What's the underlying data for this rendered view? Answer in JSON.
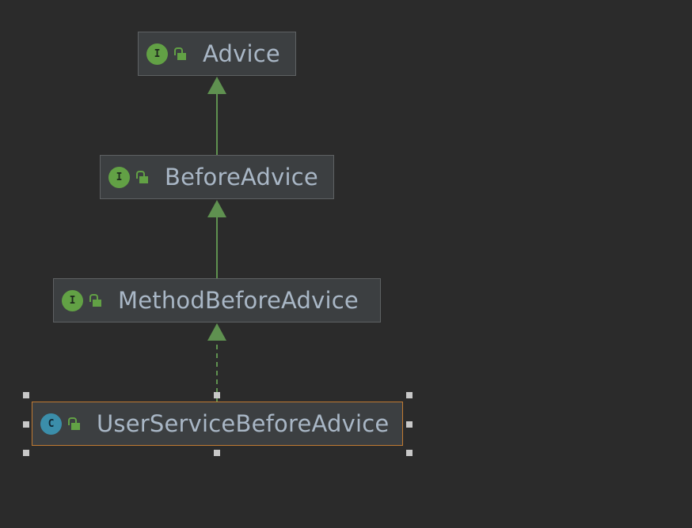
{
  "colors": {
    "background": "#2b2b2b",
    "node_fill": "#3c3f41",
    "node_border": "#5e6163",
    "selected_border": "#c07a32",
    "edge": "#5f9150",
    "interface_badge": "#62a145",
    "class_badge": "#3b8eaa",
    "text": "#a9b7c6"
  },
  "nodes": [
    {
      "id": "advice",
      "name": "Advice",
      "kind_letter": "I",
      "kind": "interface",
      "access": "public-lock-icon"
    },
    {
      "id": "before-advice",
      "name": "BeforeAdvice",
      "kind_letter": "I",
      "kind": "interface",
      "access": "public-lock-icon"
    },
    {
      "id": "method-before-advice",
      "name": "MethodBeforeAdvice",
      "kind_letter": "I",
      "kind": "interface",
      "access": "public-lock-icon"
    },
    {
      "id": "user-service-before-advice",
      "name": "UserServiceBeforeAdvice",
      "kind_letter": "C",
      "kind": "class",
      "access": "public-lock-icon",
      "selected": true
    }
  ],
  "edges": [
    {
      "from": "before-advice",
      "to": "advice",
      "relation": "extends",
      "style": "solid"
    },
    {
      "from": "method-before-advice",
      "to": "before-advice",
      "relation": "extends",
      "style": "solid"
    },
    {
      "from": "user-service-before-advice",
      "to": "method-before-advice",
      "relation": "implements",
      "style": "dashed"
    }
  ]
}
